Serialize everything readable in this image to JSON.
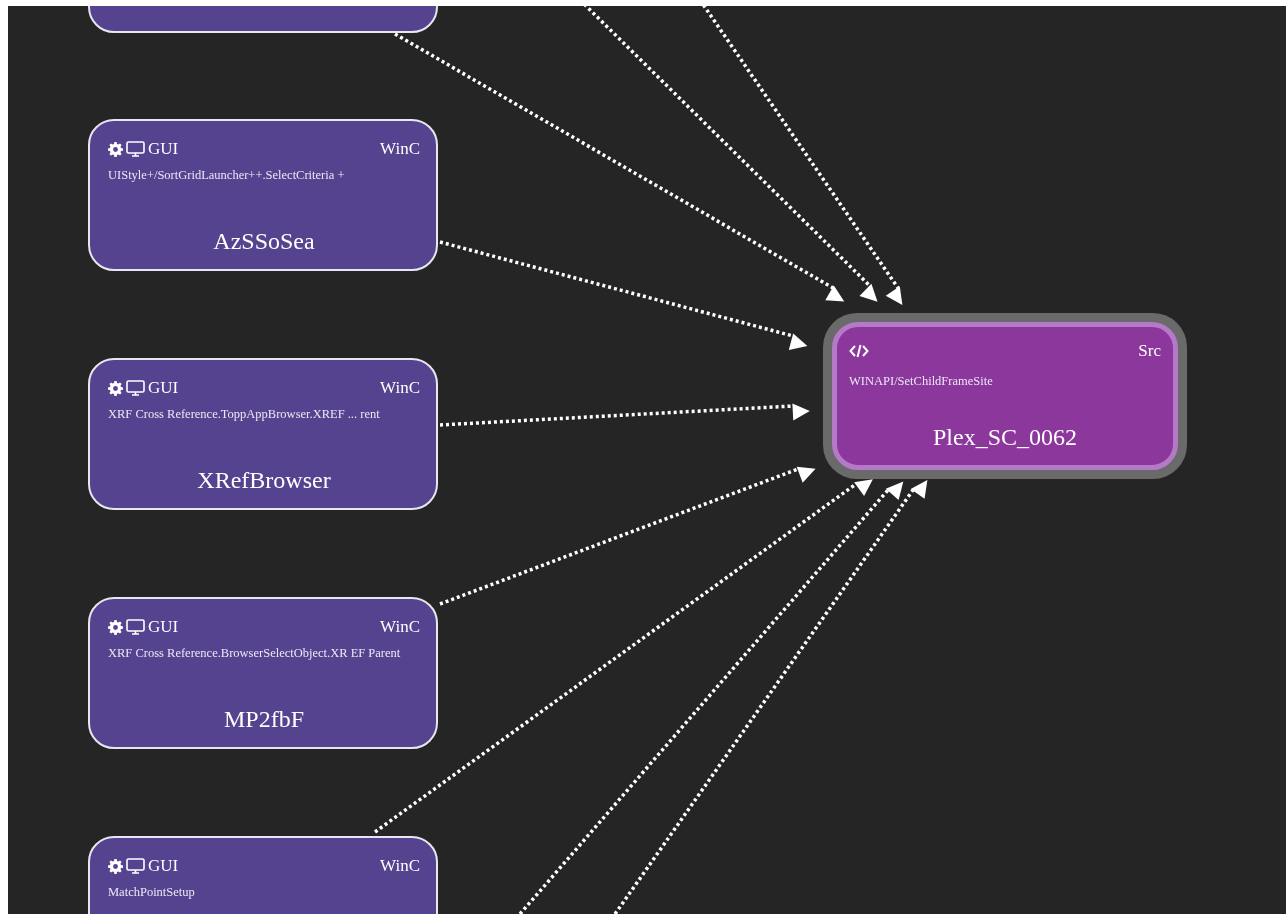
{
  "nodes": [
    {
      "kind": "gui",
      "selected": false
    },
    {
      "kind": "gui",
      "selected": false,
      "category": "GUI",
      "type": "WinC",
      "path": "UIStyle+/SortGridLauncher++.SelectCriteria +",
      "name": "AzSSoSea"
    },
    {
      "kind": "gui",
      "selected": false,
      "category": "GUI",
      "type": "WinC",
      "path": "XRF Cross Reference.ToppAppBrowser.XREF ... rent",
      "name": "XRefBrowser"
    },
    {
      "kind": "gui",
      "selected": false,
      "category": "GUI",
      "type": "WinC",
      "path": "XRF Cross Reference.BrowserSelectObject.XR EF Parent",
      "name": "MP2fbF"
    },
    {
      "kind": "gui",
      "selected": false,
      "category": "GUI",
      "type": "WinC",
      "path": "MatchPointSetup"
    },
    {
      "kind": "source",
      "selected": true,
      "type": "Src",
      "path": "WINAPI/SetChildFrameSite",
      "name": "Plex_SC_0062"
    }
  ]
}
